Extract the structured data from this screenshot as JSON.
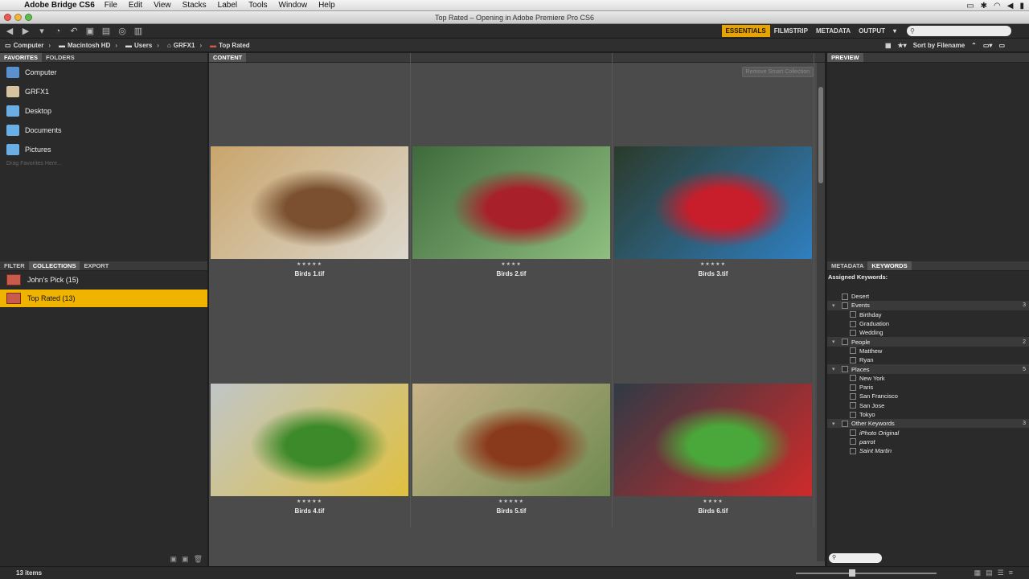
{
  "menubar": {
    "app_name": "Adobe Bridge CS6",
    "items": [
      "File",
      "Edit",
      "View",
      "Stacks",
      "Label",
      "Tools",
      "Window",
      "Help"
    ]
  },
  "window": {
    "title": "Top Rated – Opening in Adobe Premiere Pro CS6"
  },
  "workspaces": {
    "items": [
      "ESSENTIALS",
      "FILMSTRIP",
      "METADATA",
      "OUTPUT"
    ],
    "active": "ESSENTIALS"
  },
  "path": {
    "crumbs": [
      "Computer",
      "Macintosh HD",
      "Users",
      "GRFX1",
      "Top Rated"
    ],
    "sort_label": "Sort by Filename"
  },
  "left_panel": {
    "tabs": [
      "FAVORITES",
      "FOLDERS"
    ],
    "favorites": [
      {
        "label": "Computer",
        "icon": "computer-icon",
        "color": "#5a8fd0"
      },
      {
        "label": "GRFX1",
        "icon": "home-icon",
        "color": "#d8c3a0"
      },
      {
        "label": "Desktop",
        "icon": "folder-icon",
        "color": "#6aaee6"
      },
      {
        "label": "Documents",
        "icon": "folder-icon",
        "color": "#6aaee6"
      },
      {
        "label": "Pictures",
        "icon": "folder-icon",
        "color": "#6aaee6"
      }
    ],
    "drag_hint": "Drag Favorites Here...",
    "lower_tabs": [
      "FILTER",
      "COLLECTIONS",
      "EXPORT"
    ],
    "collections": [
      {
        "label": "John's Pick (15)",
        "selected": false
      },
      {
        "label": "Top Rated (13)",
        "selected": true
      }
    ]
  },
  "content": {
    "tab": "CONTENT",
    "remove_button": "Remove Smart Collection",
    "items": [
      {
        "name": "Birds 1.tif",
        "stars": "★★★★★",
        "colors": [
          "#c9a56b",
          "#7a5030",
          "#dcd8cf"
        ]
      },
      {
        "name": "Birds 2.tif",
        "stars": "★★★★",
        "colors": [
          "#3f6a3c",
          "#a8202a",
          "#8fbf80"
        ]
      },
      {
        "name": "Birds 3.tif",
        "stars": "★★★★★",
        "colors": [
          "#2b3a2a",
          "#c81d2a",
          "#2f7fc0"
        ]
      },
      {
        "name": "Birds 4.tif",
        "stars": "★★★★★",
        "colors": [
          "#c0c6c8",
          "#3d8a2a",
          "#e0c040"
        ]
      },
      {
        "name": "Birds 5.tif",
        "stars": "★★★★★",
        "colors": [
          "#c9b389",
          "#8a3a1c",
          "#6f8a50"
        ]
      },
      {
        "name": "Birds 6.tif",
        "stars": "★★★★",
        "colors": [
          "#2f3a45",
          "#4aa83a",
          "#d02a2a"
        ]
      }
    ]
  },
  "right_panel": {
    "preview_tab": "PREVIEW",
    "tabs": [
      "METADATA",
      "KEYWORDS"
    ],
    "assigned_label": "Assigned Keywords:",
    "keywords": [
      {
        "label": "Desert",
        "group": false,
        "indent": 0
      },
      {
        "label": "Events",
        "group": true,
        "count": "3"
      },
      {
        "label": "Birthday",
        "group": false,
        "indent": 1
      },
      {
        "label": "Graduation",
        "group": false,
        "indent": 1
      },
      {
        "label": "Wedding",
        "group": false,
        "indent": 1
      },
      {
        "label": "People",
        "group": true,
        "count": "2"
      },
      {
        "label": "Matthew",
        "group": false,
        "indent": 1
      },
      {
        "label": "Ryan",
        "group": false,
        "indent": 1
      },
      {
        "label": "Places",
        "group": true,
        "count": "5"
      },
      {
        "label": "New York",
        "group": false,
        "indent": 1
      },
      {
        "label": "Paris",
        "group": false,
        "indent": 1
      },
      {
        "label": "San Francisco",
        "group": false,
        "indent": 1
      },
      {
        "label": "San Jose",
        "group": false,
        "indent": 1
      },
      {
        "label": "Tokyo",
        "group": false,
        "indent": 1
      },
      {
        "label": "Other Keywords",
        "group": true,
        "count": "3"
      },
      {
        "label": "iPhoto Original",
        "group": false,
        "indent": 1,
        "italic": true
      },
      {
        "label": "parrot",
        "group": false,
        "indent": 1,
        "italic": true
      },
      {
        "label": "Saint Martin",
        "group": false,
        "indent": 1,
        "italic": true
      }
    ]
  },
  "status": {
    "items": "13 items"
  }
}
